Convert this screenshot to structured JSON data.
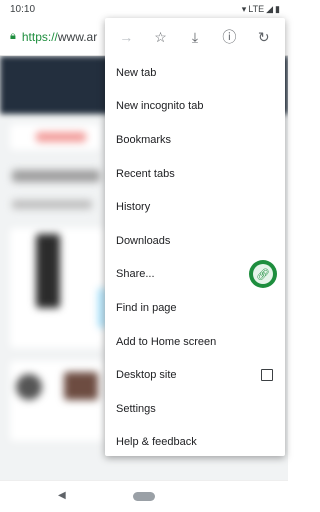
{
  "status_bar": {
    "time": "10:10",
    "network": "LTE"
  },
  "url_bar": {
    "scheme": "https://",
    "host": "www.ar"
  },
  "menu": {
    "toolbar": [
      {
        "icon": "forward-icon",
        "glyph": "→"
      },
      {
        "icon": "star-icon",
        "glyph": "☆"
      },
      {
        "icon": "download-icon",
        "glyph": "⤓"
      },
      {
        "icon": "info-icon",
        "glyph": "ⓘ"
      },
      {
        "icon": "refresh-icon",
        "glyph": "↻"
      }
    ],
    "items": [
      {
        "label": "New tab"
      },
      {
        "label": "New incognito tab"
      },
      {
        "label": "Bookmarks"
      },
      {
        "label": "Recent tabs"
      },
      {
        "label": "History"
      },
      {
        "label": "Downloads"
      },
      {
        "label": "Share..."
      },
      {
        "label": "Find in page"
      },
      {
        "label": "Add to Home screen"
      },
      {
        "label": "Desktop site",
        "checked": false
      },
      {
        "label": "Settings"
      },
      {
        "label": "Help & feedback"
      }
    ]
  },
  "colors": {
    "accent_green": "#1e8e3e",
    "page_header": "#232f3e"
  }
}
